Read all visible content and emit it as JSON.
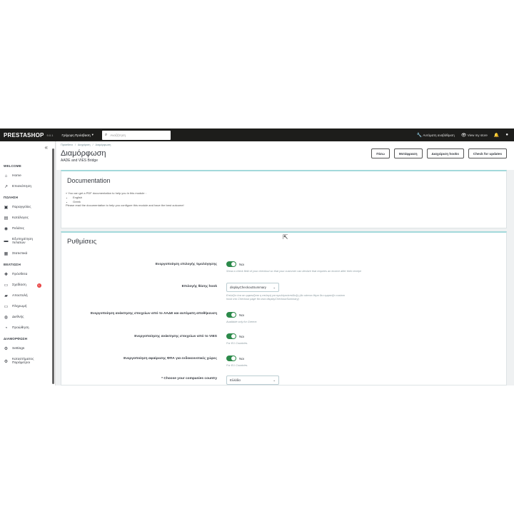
{
  "topbar": {
    "logo": "PRESTASHOP",
    "version": "9.0.1",
    "quick_access": "Γρήγορη Πρόσβαση",
    "search_placeholder": "Αναζήτηση",
    "auto_upgrade": "Αυτόματη αναβάθμιση",
    "view_store": "View my store"
  },
  "sidebar": {
    "sections": [
      {
        "title": "WELCOME",
        "items": [
          {
            "icon": "home-icon",
            "label": "Home"
          },
          {
            "icon": "trend-icon",
            "label": "Επισκόπηση"
          }
        ]
      },
      {
        "title": "ΠΩΛΗΣΗ",
        "items": [
          {
            "icon": "basket-icon",
            "label": "Παραγγελίες"
          },
          {
            "icon": "catalog-icon",
            "label": "Κατάλογος"
          },
          {
            "icon": "user-icon",
            "label": "Πελάτες"
          },
          {
            "icon": "chat-icon",
            "label": "Εξυπηρέτηση πελατών"
          },
          {
            "icon": "stats-icon",
            "label": "Στατιστικά"
          }
        ]
      },
      {
        "title": "ΒΕΛΤΙΩΣΗ",
        "items": [
          {
            "icon": "puzzle-icon",
            "label": "Πρόσθετα"
          },
          {
            "icon": "desktop-icon",
            "label": "Σχεδίαση",
            "badge": "1"
          },
          {
            "icon": "truck-icon",
            "label": "Αποστολή"
          },
          {
            "icon": "card-icon",
            "label": "Πληρωμή"
          },
          {
            "icon": "globe-icon",
            "label": "Διεθνής"
          },
          {
            "icon": "promo-icon",
            "label": "Προώθηση"
          }
        ]
      },
      {
        "title": "ΔΙΑΜΟΡΦΩΣΗ",
        "items": [
          {
            "icon": "gear-icon",
            "label": "Settings"
          },
          {
            "icon": "gears-icon",
            "label": "Καταστήματος Παράμετροι"
          }
        ]
      }
    ]
  },
  "header": {
    "breadcrumbs": [
      "Πρόσθετα",
      "Διαχείριση",
      "Διαμόρφωση"
    ],
    "title": "Διαμόρφωση",
    "subtitle": "AADE and VIES Bridge",
    "buttons": [
      "Πίσω",
      "Μετάφραση",
      "Διαχείριση hooks",
      "Check for updates"
    ]
  },
  "documentation": {
    "title": "Documentation",
    "intro": "» You can get a PDF documentation to help you in this module :",
    "languages": [
      "English",
      "Greek"
    ],
    "footer": "Please read the documentation to help you configure this module and have the best outcome!"
  },
  "settings": {
    "title": "Ρυθμίσεις",
    "yes_label": "Ναι",
    "rows": [
      {
        "label": "Ενεργοποίηση επιλογής τιμολόγησης",
        "type": "toggle",
        "help": "Show a check field of your checkout so that your customer can declare that requires an invoice after their receipt"
      },
      {
        "label": "Επιλογής θέσης hook",
        "type": "select",
        "value": "displayCheckoutSummary",
        "help": "Επιλέξτε ένα σε εμφανίζεται η επιλογή για τιμολόγιο/απόδειξη (Αν κάποιο θέμα δεν εμφανίζει custom hook στο Checkout page θα είναι displayCheckoutSummary)"
      },
      {
        "label": "Ενεργοποίηση ανάκτησης στοιχείων από το ΑΑΔΕ και αυτόματη αποθήκευση",
        "type": "toggle",
        "help": "Available only for Greece."
      },
      {
        "label": "Ενεργοποίησης ανάκτησης στοιχείων από το VIES",
        "type": "toggle",
        "help": "For EU Countries."
      },
      {
        "label": "Ενεργοποίηση αφαίρεσης ΦΠΑ για ενδοκοινοτικές χώρες",
        "type": "toggle",
        "help": "For EU Countries."
      },
      {
        "label": "* Choose your companies country",
        "type": "select",
        "value": "Ελλάδα",
        "help": ""
      }
    ]
  }
}
